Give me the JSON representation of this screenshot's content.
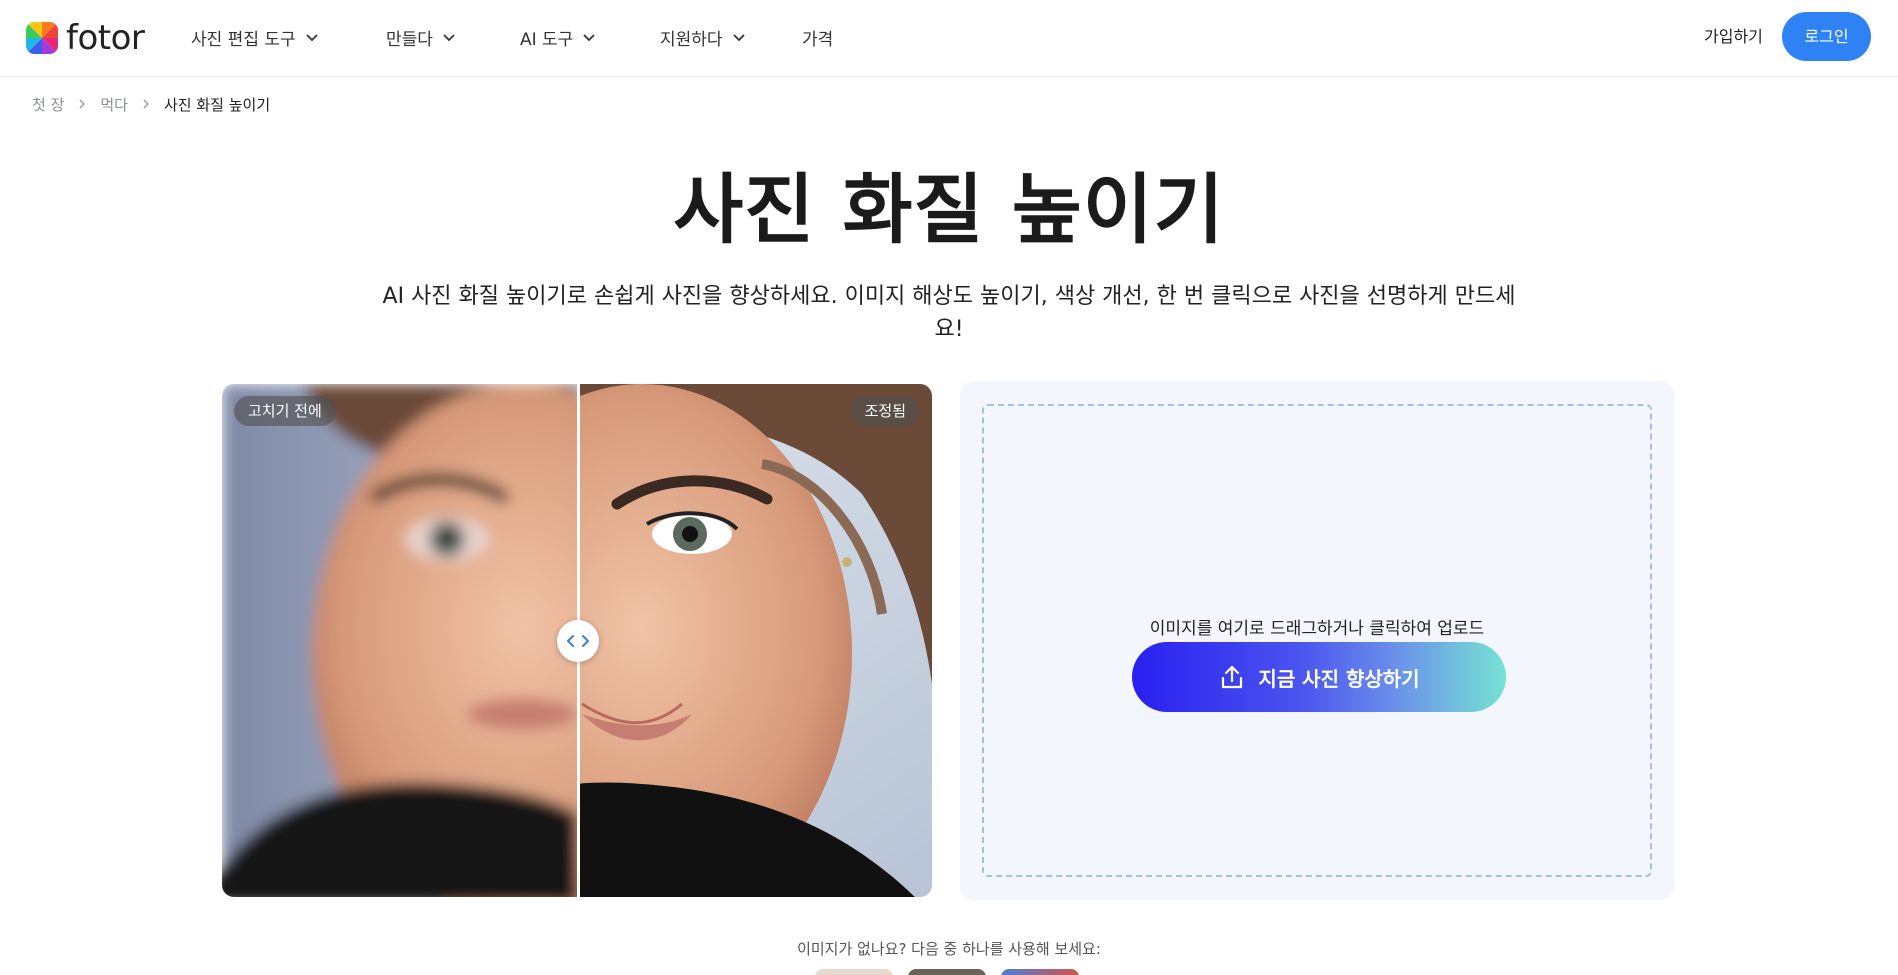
{
  "brand": {
    "name": "fotor"
  },
  "nav": {
    "items": [
      {
        "label": "사진 편집 도구",
        "dropdown": true
      },
      {
        "label": "만들다",
        "dropdown": true
      },
      {
        "label": "AI 도구",
        "dropdown": true
      },
      {
        "label": "지원하다",
        "dropdown": true
      },
      {
        "label": "가격",
        "dropdown": false
      }
    ],
    "signup_label": "가입하기",
    "login_label": "로그인"
  },
  "breadcrumb": {
    "items": [
      "첫 장",
      "먹다",
      "사진 화질 높이기"
    ]
  },
  "hero": {
    "title": "사진 화질 높이기",
    "subtitle": "AI 사진 화질 높이기로 손쉽게 사진을 향상하세요. 이미지 해상도 높이기, 색상 개선, 한 번 클릭으로 사진을 선명하게 만드세요!"
  },
  "compare": {
    "before_label": "고치기 전에",
    "after_label": "조정됨",
    "split": 0.5
  },
  "upload": {
    "hint": "이미지를 여기로 드래그하거나 클릭하여 업로드",
    "button_label": "지금 사진 향상하기"
  },
  "samples": {
    "label": "이미지가 없나요? 다음 중 하나를 사용해 보세요:"
  },
  "colors": {
    "accent": "#2f82f4",
    "cta_start": "#2a1ff0",
    "cta_end": "#76e2d4",
    "panel_bg": "#f3f6fc",
    "dropzone_border": "#9ec0ea"
  }
}
